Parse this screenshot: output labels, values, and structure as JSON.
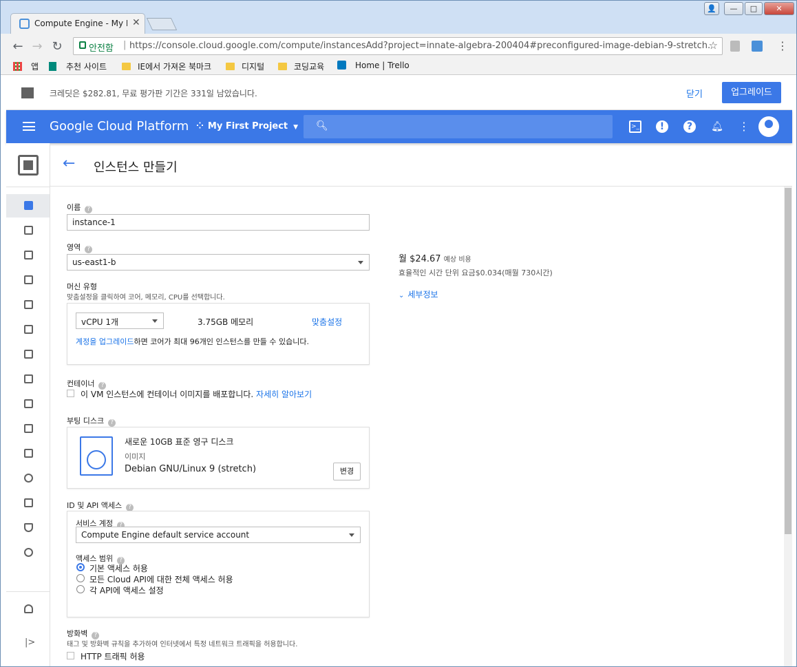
{
  "browser": {
    "tab_title": "Compute Engine - My F",
    "secure_label": "안전함",
    "url": "https://console.cloud.google.com/compute/instancesAdd?project=innate-algebra-200404#preconfigured-image-debian-9-stretch...",
    "bookmarks": [
      "앱",
      "추천 사이트",
      "IE에서 가져온 북마크",
      "디지털",
      "코딩교육",
      "Home | Trello"
    ]
  },
  "promo": {
    "message": "크레딧은 $282.81, 무료 평가판 기간은 331일 남았습니다.",
    "close_label": "닫기",
    "upgrade_label": "업그레이드"
  },
  "header": {
    "brand": "Google Cloud Platform",
    "project": "My First Project"
  },
  "page": {
    "title": "인스턴스 만들기"
  },
  "form": {
    "name_label": "이름",
    "name_value": "instance-1",
    "zone_label": "영역",
    "zone_value": "us-east1-b",
    "machine_label": "머신 유형",
    "machine_hint": "맞춤설정을 클릭하여 코어, 메모리, CPU를 선택합니다.",
    "cpu_value": "vCPU 1개",
    "memory": "3.75GB 메모리",
    "customize": "맞춤설정",
    "upgrade_link": "계정을 업그레이드",
    "upgrade_rest": "하면 코어가 최대 96개인 인스턴스를 만들 수 있습니다.",
    "container_label": "컨테이너",
    "container_text": "이 VM 인스턴스에 컨테이너 이미지를 배포합니다.",
    "container_link": "자세히 알아보기",
    "boot_label": "부팅 디스크",
    "boot_title": "새로운 10GB 표준 영구 디스크",
    "boot_image_label": "이미지",
    "boot_image": "Debian GNU/Linux 9 (stretch)",
    "boot_change": "변경",
    "api_label": "ID 및 API 액세스",
    "service_account_label": "서비스 계정",
    "service_account_value": "Compute Engine default service account",
    "scope_label": "액세스 범위",
    "scope_options": [
      "기본 액세스 허용",
      "모든 Cloud API에 대한 전체 액세스 허용",
      "각 API에 액세스 설정"
    ],
    "firewall_label": "방화벽",
    "firewall_hint": "태그 및 방화벽 규칙을 추가하여 인터넷에서 특정 네트워크 트래픽을 허용합니다.",
    "http_label": "HTTP 트래픽 허용"
  },
  "cost": {
    "monthly": "월 $24.67",
    "monthly_suffix": "예상 비용",
    "hourly": "효율적인 시간 단위 요금$0.034(매월 730시간)",
    "details": "세부정보"
  }
}
